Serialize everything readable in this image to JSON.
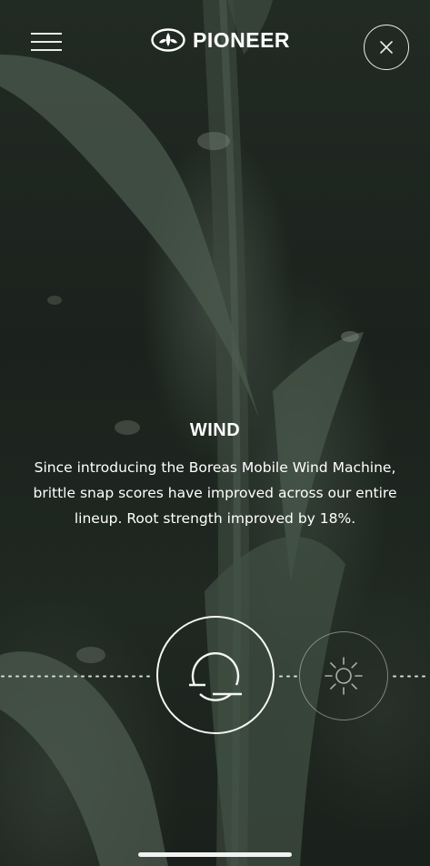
{
  "header": {
    "brand": "PIONEER",
    "menu_icon": "hamburger-menu-icon",
    "close_icon": "close-icon"
  },
  "feature": {
    "title": "WIND",
    "description": "Since introducing the Boreas Mobile Wind Machine, brittle snap scores have improved across our entire lineup. Root strength improved by 18%."
  },
  "carousel": {
    "active_icon": "wind-icon",
    "next_icon": "sun-icon"
  },
  "colors": {
    "foreground": "#ffffff",
    "background": "#1c221d"
  }
}
